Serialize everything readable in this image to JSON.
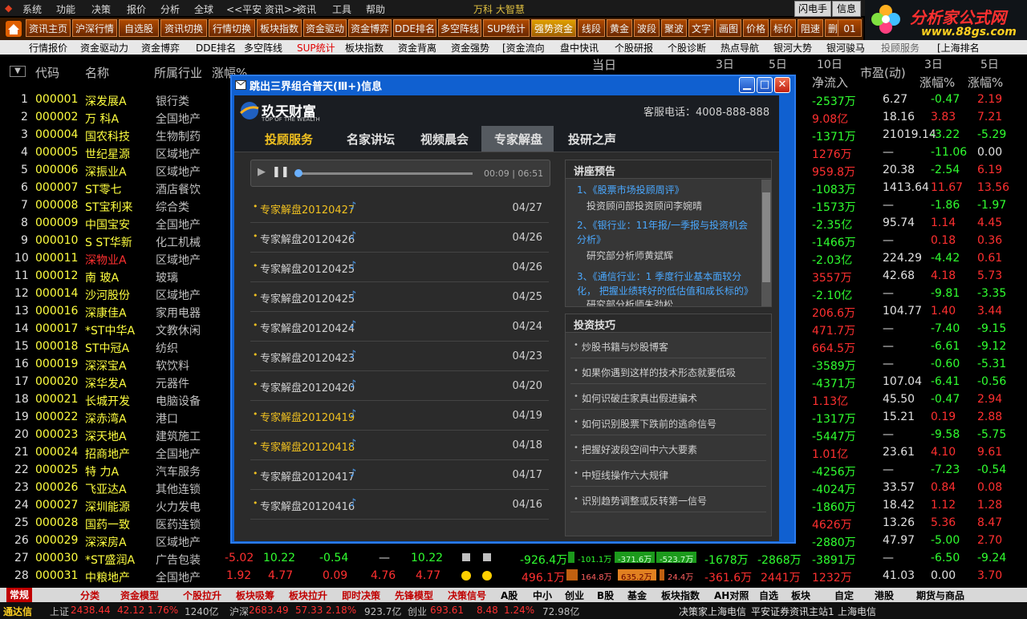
{
  "menu": [
    "系统",
    "功能",
    "决策",
    "报价",
    "分析",
    "全球",
    "<<平安 资讯>>",
    "资讯",
    "工具",
    "帮助"
  ],
  "titlebar_text": "万科 大智慧",
  "buttons_right": {
    "flash": "闪电手",
    "info": "信息"
  },
  "logo": {
    "title": "分析家公式网",
    "url": "www.88gs.com"
  },
  "toolbar": [
    "资讯主页",
    "沪深行情",
    "自选股",
    "资讯切换",
    "行情切换",
    "板块指数",
    "资金驱动",
    "资金博弈",
    "DDE排名",
    "多空阵线",
    "SUP统计",
    "强势资金",
    "线段",
    "黄金",
    "波段",
    "聚波",
    "文字",
    "画图",
    "价格",
    "标价",
    "阻速",
    "删除",
    "01"
  ],
  "tabs": [
    "行情报价",
    "资金驱动力",
    "资金博弈",
    "DDE排名",
    "多空阵线",
    "SUP统计",
    "板块指数",
    "资金背离",
    "资金强势",
    "[资金流向",
    "盘中快讯",
    "个股研报",
    "个股诊断",
    "热点导航",
    "银河大势",
    "银河骏马",
    "投顾服务",
    "[上海排名"
  ],
  "header": {
    "code": "代码",
    "name": "名称",
    "industry": "所属行业",
    "change": "涨幅%",
    "today": "当日",
    "d3": "3日",
    "d5": "5日",
    "d10": "10日",
    "net_inflow": "净流入",
    "mcap": "市盈(动)",
    "chg3": "涨幅%",
    "chg5": "涨幅%",
    "h3": "3日",
    "h5": "5日"
  },
  "rows": [
    {
      "n": "1",
      "code": "000001",
      "name": "深发展A",
      "ind": "银行类",
      "net": "-2537万",
      "pe": "6.27",
      "c3": "-0.47",
      "c5": "2.19"
    },
    {
      "n": "2",
      "code": "000002",
      "name": "万 科A",
      "ind": "全国地产",
      "net": "9.08亿",
      "pe": "18.16",
      "c3": "3.83",
      "c5": "7.21"
    },
    {
      "n": "3",
      "code": "000004",
      "name": "国农科技",
      "ind": "生物制药",
      "net": "-1371万",
      "pe": "21019.14",
      "c3": "-3.22",
      "c5": "-5.29"
    },
    {
      "n": "4",
      "code": "000005",
      "name": "世纪星源",
      "ind": "区域地产",
      "net": "1276万",
      "pe": "—",
      "c3": "-11.06",
      "c5": "0.00"
    },
    {
      "n": "5",
      "code": "000006",
      "name": "深振业A",
      "ind": "区域地产",
      "net": "959.8万",
      "pe": "20.38",
      "c3": "-2.54",
      "c5": "6.19"
    },
    {
      "n": "6",
      "code": "000007",
      "name": "ST零七",
      "ind": "酒店餐饮",
      "net": "-1083万",
      "pe": "1413.64",
      "c3": "11.67",
      "c5": "13.56"
    },
    {
      "n": "7",
      "code": "000008",
      "name": "ST宝利来",
      "ind": "综合类",
      "net": "-1573万",
      "pe": "—",
      "c3": "-1.86",
      "c5": "-1.97"
    },
    {
      "n": "8",
      "code": "000009",
      "name": "中国宝安",
      "ind": "全国地产",
      "net": "-2.35亿",
      "pe": "95.74",
      "c3": "1.14",
      "c5": "4.45"
    },
    {
      "n": "9",
      "code": "000010",
      "name": "S ST华新",
      "ind": "化工机械",
      "net": "-1466万",
      "pe": "—",
      "c3": "0.18",
      "c5": "0.36"
    },
    {
      "n": "10",
      "code": "000011",
      "name": "深物业A",
      "ind": "区域地产",
      "net": "-2.03亿",
      "pe": "224.29",
      "c3": "-4.42",
      "c5": "0.61"
    },
    {
      "n": "11",
      "code": "000012",
      "name": "南 玻A",
      "ind": "玻璃",
      "net": "3557万",
      "pe": "42.68",
      "c3": "4.18",
      "c5": "5.73"
    },
    {
      "n": "12",
      "code": "000014",
      "name": "沙河股份",
      "ind": "区域地产",
      "net": "-2.10亿",
      "pe": "—",
      "c3": "-9.81",
      "c5": "-3.35"
    },
    {
      "n": "13",
      "code": "000016",
      "name": "深康佳A",
      "ind": "家用电器",
      "net": "206.6万",
      "pe": "104.77",
      "c3": "1.40",
      "c5": "3.44"
    },
    {
      "n": "14",
      "code": "000017",
      "name": "*ST中华A",
      "ind": "文教休闲",
      "net": "471.7万",
      "pe": "—",
      "c3": "-7.40",
      "c5": "-9.15"
    },
    {
      "n": "15",
      "code": "000018",
      "name": "ST中冠A",
      "ind": "纺织",
      "net": "664.5万",
      "pe": "—",
      "c3": "-6.61",
      "c5": "-9.12"
    },
    {
      "n": "16",
      "code": "000019",
      "name": "深深宝A",
      "ind": "软饮料",
      "net": "-3589万",
      "pe": "—",
      "c3": "-0.60",
      "c5": "-5.31"
    },
    {
      "n": "17",
      "code": "000020",
      "name": "深华发A",
      "ind": "元器件",
      "net": "-4371万",
      "pe": "107.04",
      "c3": "-6.41",
      "c5": "-0.56"
    },
    {
      "n": "18",
      "code": "000021",
      "name": "长城开发",
      "ind": "电脑设备",
      "net": "1.13亿",
      "pe": "45.50",
      "c3": "-0.47",
      "c5": "2.94"
    },
    {
      "n": "19",
      "code": "000022",
      "name": "深赤湾A",
      "ind": "港口",
      "net": "-1317万",
      "pe": "15.21",
      "c3": "0.19",
      "c5": "2.88"
    },
    {
      "n": "20",
      "code": "000023",
      "name": "深天地A",
      "ind": "建筑施工",
      "net": "-5447万",
      "pe": "—",
      "c3": "-9.58",
      "c5": "-5.75"
    },
    {
      "n": "21",
      "code": "000024",
      "name": "招商地产",
      "ind": "全国地产",
      "net": "1.01亿",
      "pe": "23.61",
      "c3": "4.10",
      "c5": "9.61"
    },
    {
      "n": "22",
      "code": "000025",
      "name": "特 力A",
      "ind": "汽车服务",
      "net": "-4256万",
      "pe": "—",
      "c3": "-7.23",
      "c5": "-0.54"
    },
    {
      "n": "23",
      "code": "000026",
      "name": "飞亚达A",
      "ind": "其他连锁",
      "net": "-4024万",
      "pe": "33.57",
      "c3": "0.84",
      "c5": "0.08"
    },
    {
      "n": "24",
      "code": "000027",
      "name": "深圳能源",
      "ind": "火力发电",
      "net": "-1860万",
      "pe": "18.42",
      "c3": "1.12",
      "c5": "1.28"
    },
    {
      "n": "25",
      "code": "000028",
      "name": "国药一致",
      "ind": "医药连锁",
      "net": "4626万",
      "pe": "13.26",
      "c3": "5.36",
      "c5": "8.47"
    },
    {
      "n": "26",
      "code": "000029",
      "name": "深深房A",
      "ind": "区域地产",
      "net": "-2880万",
      "pe": "47.97",
      "c3": "-5.00",
      "c5": "2.70"
    },
    {
      "n": "27",
      "code": "000030",
      "name": "*ST盛润A",
      "ind": "广告包装",
      "net": "-3891万",
      "pe": "—",
      "c3": "-6.50",
      "c5": "-9.24"
    },
    {
      "n": "28",
      "code": "000031",
      "name": "中粮地产",
      "ind": "全国地产",
      "net": "1232万",
      "pe": "41.03",
      "c3": "0.00",
      "c5": "3.70"
    }
  ],
  "row27_extra": {
    "chg": "-5.02",
    "v1": "10.22",
    "v2": "-0.54",
    "v3": "—",
    "v4": "10.22",
    "amt": "-926.4万",
    "b1": "-101.1万",
    "b2": "-371.6万",
    "b3": "-523.7万",
    "d3": "-1678万",
    "d5": "-2868万"
  },
  "row28_extra": {
    "chg": "1.92",
    "v1": "4.77",
    "v2": "0.09",
    "v3": "4.76",
    "v4": "4.77",
    "amt": "496.1万",
    "b1": "164.8万",
    "b2": "635.2万",
    "b3": "24.4万",
    "d3": "-361.6万",
    "d5": "2441万"
  },
  "dialog": {
    "title": "跳出三界组合普天(Ⅲ+)信息",
    "brand": "玖天财富",
    "brand_sub": "TOP OF THE WEALTH",
    "hotline": "客服电话：4008-888-888",
    "nav": [
      "投顾服务",
      "名家讲坛",
      "视频晨会",
      "专家解盘",
      "投研之声"
    ],
    "player_time": "00:09 | 06:51",
    "list": [
      {
        "title": "专家解盘20120427",
        "date": "04/27"
      },
      {
        "title": "专家解盘20120426",
        "date": "04/26"
      },
      {
        "title": "专家解盘20120425",
        "date": "04/26"
      },
      {
        "title": "专家解盘20120425",
        "date": "04/25"
      },
      {
        "title": "专家解盘20120424",
        "date": "04/24"
      },
      {
        "title": "专家解盘20120423",
        "date": "04/23"
      },
      {
        "title": "专家解盘20120420",
        "date": "04/20"
      },
      {
        "title": "专家解盘20120419",
        "date": "04/19"
      },
      {
        "title": "专家解盘20120418",
        "date": "04/18"
      },
      {
        "title": "专家解盘20120417",
        "date": "04/17"
      },
      {
        "title": "专家解盘20120416",
        "date": "04/16"
      }
    ],
    "lecture_header": "讲座预告",
    "lectures": [
      {
        "title": "1、《股票市场投顾周评》",
        "sub": "投资顾问部投资顾问李婉晴"
      },
      {
        "title": "2、《银行业：11年报/一季报与投资机会分析》",
        "sub": "研究部分析师黄斌辉"
      },
      {
        "title": "3、《通信行业：1 季度行业基本面较分化， 把握业绩转好的低估值和成长标的》",
        "sub": "研究部分析师朱劲松"
      }
    ],
    "tips_header": "投资技巧",
    "tips": [
      "炒股书籍与炒股博客",
      "如果你遇到这样的技术形态就要低吸",
      "如何识破庄家真出假进骗术",
      "如何识别股票下跌前的逃命信号",
      "把握好波段空间中六大要素",
      "中短线操作六大规律",
      "识别趋势调整或反转第一信号"
    ]
  },
  "bottom_tabs": [
    "常规",
    "分类",
    "资金模型",
    "个股拉升",
    "板块吸筹",
    "板块拉升",
    "即时决策",
    "先锋模型",
    "决策信号",
    "A股",
    "中小",
    "创业",
    "B股",
    "基金",
    "板块指数",
    "AH对照",
    "自选",
    "板块",
    "自定",
    "港股",
    "期货与商品"
  ],
  "status": {
    "app": "通达信",
    "sh": "上证",
    "sh_val": "2438.44",
    "sh_chg": "42.12",
    "sh_pct": "1.76%",
    "sh_amt": "1240亿",
    "hs": "沪深",
    "hs_val": "2683.49",
    "hs_chg": "57.33",
    "hs_pct": "2.18%",
    "hs_amt": "923.7亿",
    "cy": "创业",
    "cy_val": "693.61",
    "cy_chg": "8.48",
    "cy_pct": "1.24%",
    "cy_amt": "72.98亿",
    "right1": "决策家上海电信",
    "right2": "平安证券资讯主站1",
    "right3": "上海电信"
  },
  "colors": {
    "up": "#ff3030",
    "down": "#30ff30",
    "code": "#ffff40",
    "accent": "#1060d0"
  }
}
